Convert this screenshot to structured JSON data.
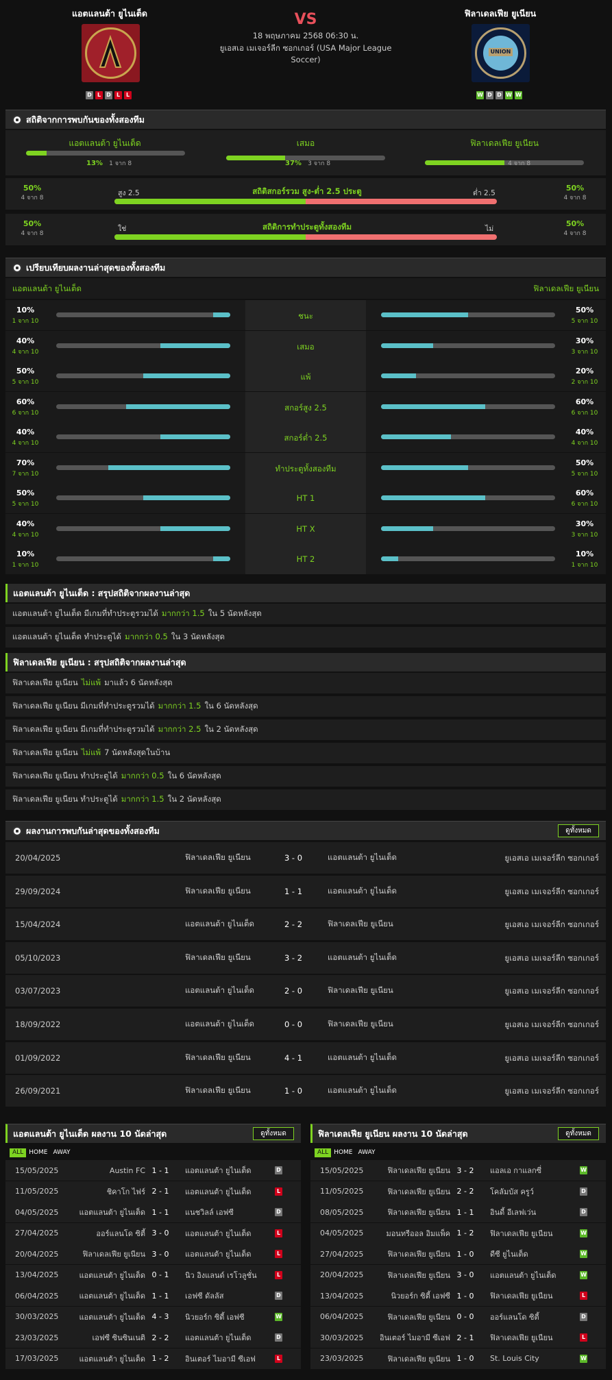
{
  "match": {
    "home": "แอตแลนต้า ยูไนเต็ด",
    "away": "ฟิลาเดลเฟีย ยูเนียน",
    "vs": "VS",
    "date": "18 พฤษภาคม 2568 06:30 น.",
    "league": "ยูเอสเอ เมเจอร์ลีก ซอกเกอร์ (USA Major League Soccer)",
    "home_form": [
      "D",
      "L",
      "D",
      "L",
      "L"
    ],
    "away_form": [
      "W",
      "D",
      "D",
      "W",
      "W"
    ],
    "home_logo_text": "ATLANTA UNITED FC",
    "away_logo_text": "PHILADELPHIA UNION"
  },
  "h2hstats": {
    "title": "สถิติจากการพบกันของทั้งสองทีม",
    "cols": [
      {
        "name": "แอตแลนต้า ยูไนเต็ด",
        "pct": "13%",
        "of": "1 จาก 8",
        "fill": 0.13
      },
      {
        "name": "เสมอ",
        "pct": "37%",
        "of": "3 จาก 8",
        "fill": 0.37
      },
      {
        "name": "ฟิลาเดลเฟีย ยูเนียน",
        "pct": "50%",
        "of": "4 จาก 8",
        "fill": 0.5
      }
    ],
    "rows": [
      {
        "lpct": "50%",
        "lof": "4 จาก 8",
        "llabel": "สูง 2.5",
        "title": "สถิติสกอร์รวม สูง-ต่ำ 2.5 ประตู",
        "rlabel": "ต่ำ 2.5",
        "rpct": "50%",
        "rof": "4 จาก 8",
        "fill": 0.5
      },
      {
        "lpct": "50%",
        "lof": "4 จาก 8",
        "llabel": "ใช่",
        "title": "สถิติการทำประตูทั้งสองทีม",
        "rlabel": "ไม่",
        "rpct": "50%",
        "rof": "4 จาก 8",
        "fill": 0.5
      }
    ]
  },
  "compare": {
    "title": "เปรียบเทียบผลงานล่าสุดของทั้งสองทีม",
    "home": "แอตแลนต้า ยูไนเต็ด",
    "away": "ฟิลาเดลเฟีย ยูเนียน",
    "rows": [
      {
        "label": "ชนะ",
        "lp": "10%",
        "lo": "1 จาก 10",
        "lf": 0.1,
        "rp": "50%",
        "ro": "5 จาก 10",
        "rf": 0.5
      },
      {
        "label": "เสมอ",
        "lp": "40%",
        "lo": "4 จาก 10",
        "lf": 0.4,
        "rp": "30%",
        "ro": "3 จาก 10",
        "rf": 0.3
      },
      {
        "label": "แพ้",
        "lp": "50%",
        "lo": "5 จาก 10",
        "lf": 0.5,
        "rp": "20%",
        "ro": "2 จาก 10",
        "rf": 0.2
      },
      {
        "label": "สกอร์สูง 2.5",
        "lp": "60%",
        "lo": "6 จาก 10",
        "lf": 0.6,
        "rp": "60%",
        "ro": "6 จาก 10",
        "rf": 0.6
      },
      {
        "label": "สกอร์ต่ำ 2.5",
        "lp": "40%",
        "lo": "4 จาก 10",
        "lf": 0.4,
        "rp": "40%",
        "ro": "4 จาก 10",
        "rf": 0.4
      },
      {
        "label": "ทำประตูทั้งสองทีม",
        "lp": "70%",
        "lo": "7 จาก 10",
        "lf": 0.7,
        "rp": "50%",
        "ro": "5 จาก 10",
        "rf": 0.5
      },
      {
        "label": "HT 1",
        "lp": "50%",
        "lo": "5 จาก 10",
        "lf": 0.5,
        "rp": "60%",
        "ro": "6 จาก 10",
        "rf": 0.6
      },
      {
        "label": "HT X",
        "lp": "40%",
        "lo": "4 จาก 10",
        "lf": 0.4,
        "rp": "30%",
        "ro": "3 จาก 10",
        "rf": 0.3
      },
      {
        "label": "HT 2",
        "lp": "10%",
        "lo": "1 จาก 10",
        "lf": 0.1,
        "rp": "10%",
        "ro": "1 จาก 10",
        "rf": 0.1
      }
    ]
  },
  "summary_home": {
    "title": "แอตแลนต้า ยูไนเต็ด : สรุปสถิติจากผลงานล่าสุด",
    "rows": [
      [
        "แอตแลนต้า ยูไนเต็ด มีเกมที่ทำประตูรวมได้",
        "มากกว่า  1.5",
        "ใน 5 นัดหลังสุด"
      ],
      [
        "แอตแลนต้า ยูไนเต็ด ทำประตูได้",
        "มากกว่า  0.5",
        "ใน 3 นัดหลังสุด"
      ]
    ]
  },
  "summary_away": {
    "title": "ฟิลาเดลเฟีย ยูเนียน : สรุปสถิติจากผลงานล่าสุด",
    "rows": [
      [
        "ฟิลาเดลเฟีย ยูเนียน",
        "ไม่แพ้",
        "มาแล้ว 6 นัดหลังสุด"
      ],
      [
        "ฟิลาเดลเฟีย ยูเนียน มีเกมที่ทำประตูรวมได้",
        "มากกว่า  1.5",
        "ใน 6 นัดหลังสุด"
      ],
      [
        "ฟิลาเดลเฟีย ยูเนียน มีเกมที่ทำประตูรวมได้",
        "มากกว่า  2.5",
        "ใน 2 นัดหลังสุด"
      ],
      [
        "ฟิลาเดลเฟีย ยูเนียน",
        "ไม่แพ้",
        "7  นัดหลังสุดในบ้าน"
      ],
      [
        "ฟิลาเดลเฟีย ยูเนียน ทำประตูได้",
        "มากกว่า  0.5",
        "ใน 6 นัดหลังสุด"
      ],
      [
        "ฟิลาเดลเฟีย ยูเนียน ทำประตูได้",
        "มากกว่า  1.5",
        "ใน 2 นัดหลังสุด"
      ]
    ]
  },
  "h2h": {
    "title": "ผลงานการพบกันล่าสุดของทั้งสองทีม",
    "button": "ดูทั้งหมด",
    "rows": [
      [
        "20/04/2025",
        "ฟิลาเดลเฟีย ยูเนียน",
        "3 - 0",
        "แอตแลนต้า ยูไนเต็ด",
        "ยูเอสเอ เมเจอร์ลีก ซอกเกอร์"
      ],
      [
        "29/09/2024",
        "ฟิลาเดลเฟีย ยูเนียน",
        "1 - 1",
        "แอตแลนต้า ยูไนเต็ด",
        "ยูเอสเอ เมเจอร์ลีก ซอกเกอร์"
      ],
      [
        "15/04/2024",
        "แอตแลนต้า ยูไนเต็ด",
        "2 - 2",
        "ฟิลาเดลเฟีย ยูเนียน",
        "ยูเอสเอ เมเจอร์ลีก ซอกเกอร์"
      ],
      [
        "05/10/2023",
        "ฟิลาเดลเฟีย ยูเนียน",
        "3 - 2",
        "แอตแลนต้า ยูไนเต็ด",
        "ยูเอสเอ เมเจอร์ลีก ซอกเกอร์"
      ],
      [
        "03/07/2023",
        "แอตแลนต้า ยูไนเต็ด",
        "2 - 0",
        "ฟิลาเดลเฟีย ยูเนียน",
        "ยูเอสเอ เมเจอร์ลีก ซอกเกอร์"
      ],
      [
        "18/09/2022",
        "แอตแลนต้า ยูไนเต็ด",
        "0 - 0",
        "ฟิลาเดลเฟีย ยูเนียน",
        "ยูเอสเอ เมเจอร์ลีก ซอกเกอร์"
      ],
      [
        "01/09/2022",
        "ฟิลาเดลเฟีย ยูเนียน",
        "4 - 1",
        "แอตแลนต้า ยูไนเต็ด",
        "ยูเอสเอ เมเจอร์ลีก ซอกเกอร์"
      ],
      [
        "26/09/2021",
        "ฟิลาเดลเฟีย ยูเนียน",
        "1 - 0",
        "แอตแลนต้า ยูไนเต็ด",
        "ยูเอสเอ เมเจอร์ลีก ซอกเกอร์"
      ]
    ]
  },
  "last10_home": {
    "title": "แอตแลนต้า ยูไนเต็ด ผลงาน 10 นัดล่าสุด",
    "button": "ดูทั้งหมด",
    "tabs": [
      "ALL",
      "HOME",
      "AWAY"
    ],
    "rows": [
      [
        "15/05/2025",
        "Austin FC",
        "1 - 1",
        "แอตแลนต้า ยูไนเต็ด",
        "D"
      ],
      [
        "11/05/2025",
        "ชิคาโก ไฟร์",
        "2 - 1",
        "แอตแลนต้า ยูไนเต็ด",
        "L"
      ],
      [
        "04/05/2025",
        "แอตแลนต้า ยูไนเต็ด",
        "1 - 1",
        "แนชวิลล์ เอฟซี",
        "D"
      ],
      [
        "27/04/2025",
        "ออร์แลนโด ซิตี้",
        "3 - 0",
        "แอตแลนต้า ยูไนเต็ด",
        "L"
      ],
      [
        "20/04/2025",
        "ฟิลาเดลเฟีย ยูเนียน",
        "3 - 0",
        "แอตแลนต้า ยูไนเต็ด",
        "L"
      ],
      [
        "13/04/2025",
        "แอตแลนต้า ยูไนเต็ด",
        "0 - 1",
        "นิว อิงแลนด์ เรโวลูชั่น",
        "L"
      ],
      [
        "06/04/2025",
        "แอตแลนต้า ยูไนเต็ด",
        "1 - 1",
        "เอฟซี ดัลลัส",
        "D"
      ],
      [
        "30/03/2025",
        "แอตแลนต้า ยูไนเต็ด",
        "4 - 3",
        "นิวยอร์ก ซิตี้ เอฟซี",
        "W"
      ],
      [
        "23/03/2025",
        "เอฟซี ซินซินเนติ",
        "2 - 2",
        "แอตแลนต้า ยูไนเต็ด",
        "D"
      ],
      [
        "17/03/2025",
        "แอตแลนต้า ยูไนเต็ด",
        "1 - 2",
        "อินเตอร์ ไมอามี ซีเอฟ",
        "L"
      ]
    ]
  },
  "last10_away": {
    "title": "ฟิลาเดลเฟีย ยูเนียน ผลงาน 10 นัดล่าสุด",
    "button": "ดูทั้งหมด",
    "tabs": [
      "ALL",
      "HOME",
      "AWAY"
    ],
    "rows": [
      [
        "15/05/2025",
        "ฟิลาเดลเฟีย ยูเนียน",
        "3 - 2",
        "แอลเอ กาแลกซี่",
        "W"
      ],
      [
        "11/05/2025",
        "ฟิลาเดลเฟีย ยูเนียน",
        "2 - 2",
        "โคลัมบัส ครูว์",
        "D"
      ],
      [
        "08/05/2025",
        "ฟิลาเดลเฟีย ยูเนียน",
        "1 - 1",
        "อินดี้ อีเลฟเว่น",
        "D"
      ],
      [
        "04/05/2025",
        "มอนทรีออล อิมแพ็ค",
        "1 - 2",
        "ฟิลาเดลเฟีย ยูเนียน",
        "W"
      ],
      [
        "27/04/2025",
        "ฟิลาเดลเฟีย ยูเนียน",
        "1 - 0",
        "ดีซี ยูไนเต็ด",
        "W"
      ],
      [
        "20/04/2025",
        "ฟิลาเดลเฟีย ยูเนียน",
        "3 - 0",
        "แอตแลนต้า ยูไนเต็ด",
        "W"
      ],
      [
        "13/04/2025",
        "นิวยอร์ก ซิตี้ เอฟซี",
        "1 - 0",
        "ฟิลาเดลเฟีย ยูเนียน",
        "L"
      ],
      [
        "06/04/2025",
        "ฟิลาเดลเฟีย ยูเนียน",
        "0 - 0",
        "ออร์แลนโด ซิตี้",
        "D"
      ],
      [
        "30/03/2025",
        "อินเตอร์ ไมอามี ซีเอฟ",
        "2 - 1",
        "ฟิลาเดลเฟีย ยูเนียน",
        "L"
      ],
      [
        "23/03/2025",
        "ฟิลาเดลเฟีย ยูเนียน",
        "1 - 0",
        "St. Louis City",
        "W"
      ]
    ]
  }
}
